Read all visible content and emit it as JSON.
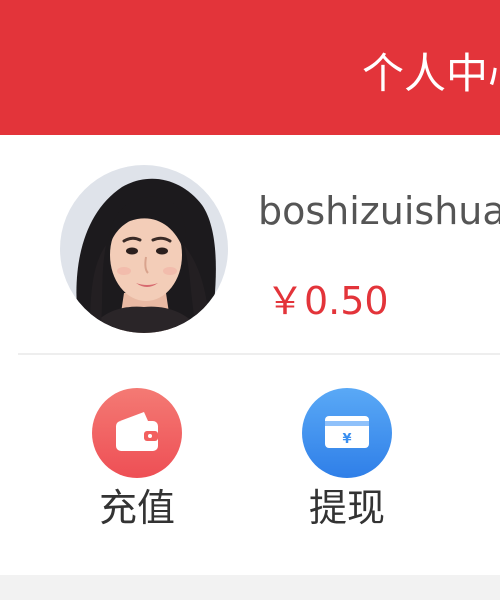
{
  "header": {
    "title": "个人中心"
  },
  "profile": {
    "avatar": "avatar-photo",
    "username": "boshizuishuai",
    "balance": "￥0.50"
  },
  "actions": [
    {
      "label": "充值",
      "icon": "wallet-icon",
      "color": "#f2605f"
    },
    {
      "label": "提现",
      "icon": "yen-card-icon",
      "color": "#3a8ff0"
    }
  ],
  "colors": {
    "accent": "#e3343a",
    "background_band": "#f2f2f2"
  }
}
